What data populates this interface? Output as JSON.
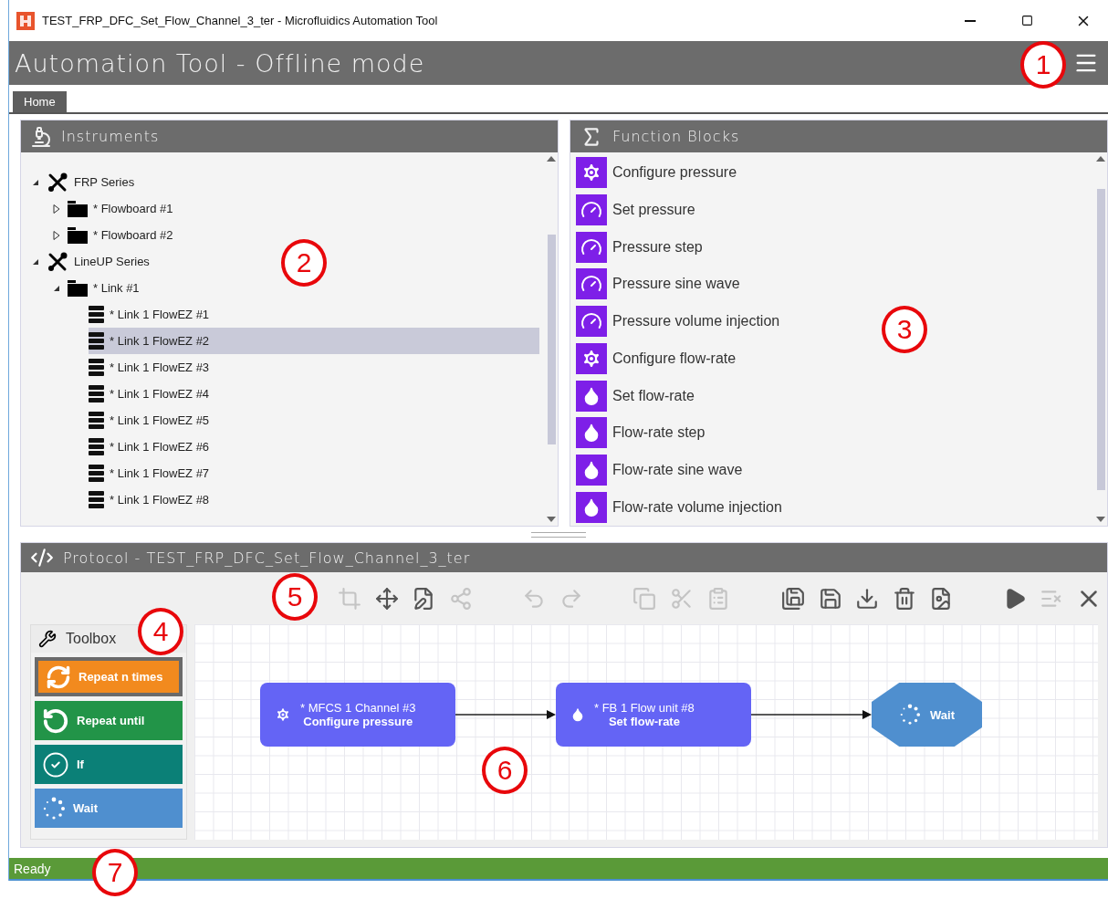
{
  "window": {
    "title": "TEST_FRP_DFC_Set_Flow_Channel_3_ter - Microfluidics Automation Tool"
  },
  "header": {
    "title": "Automation Tool - Offline mode"
  },
  "tabs": [
    {
      "label": "Home",
      "selected": true
    }
  ],
  "instruments": {
    "title": "Instruments",
    "tree": [
      {
        "kind": "series",
        "label": "FRP Series",
        "expanded": true,
        "selected": false,
        "children": [
          {
            "kind": "folder",
            "label": "* Flowboard #1",
            "expanded": false,
            "selected": false
          },
          {
            "kind": "folder",
            "label": "* Flowboard #2",
            "expanded": false,
            "selected": false
          }
        ]
      },
      {
        "kind": "series",
        "label": "LineUP Series",
        "expanded": true,
        "selected": false,
        "children": [
          {
            "kind": "folder",
            "label": "* Link #1",
            "expanded": true,
            "selected": false,
            "children": [
              {
                "kind": "device",
                "label": "* Link 1 FlowEZ #1",
                "selected": false
              },
              {
                "kind": "device",
                "label": "* Link 1 FlowEZ #2",
                "selected": true
              },
              {
                "kind": "device",
                "label": "* Link 1 FlowEZ #3",
                "selected": false
              },
              {
                "kind": "device",
                "label": "* Link 1 FlowEZ #4",
                "selected": false
              },
              {
                "kind": "device",
                "label": "* Link 1 FlowEZ #5",
                "selected": false
              },
              {
                "kind": "device",
                "label": "* Link 1 FlowEZ #6",
                "selected": false
              },
              {
                "kind": "device",
                "label": "* Link 1 FlowEZ #7",
                "selected": false
              },
              {
                "kind": "device",
                "label": "* Link 1 FlowEZ #8",
                "selected": false
              }
            ]
          }
        ]
      }
    ]
  },
  "function_blocks": {
    "title": "Function Blocks",
    "items": [
      {
        "kind": "gear",
        "label": "Configure pressure"
      },
      {
        "kind": "gauge",
        "label": "Set pressure"
      },
      {
        "kind": "gauge",
        "label": "Pressure step"
      },
      {
        "kind": "gauge",
        "label": "Pressure sine wave"
      },
      {
        "kind": "gauge",
        "label": "Pressure volume injection"
      },
      {
        "kind": "gear",
        "label": "Configure flow-rate"
      },
      {
        "kind": "drop",
        "label": "Set flow-rate"
      },
      {
        "kind": "drop",
        "label": "Flow-rate step"
      },
      {
        "kind": "drop",
        "label": "Flow-rate sine wave"
      },
      {
        "kind": "drop",
        "label": "Flow-rate volume injection"
      }
    ]
  },
  "protocol": {
    "title": "Protocol - TEST_FRP_DFC_Set_Flow_Channel_3_ter",
    "toolbar": [
      {
        "kind": "crop",
        "disabled": true
      },
      {
        "kind": "move",
        "disabled": false
      },
      {
        "kind": "edit",
        "disabled": false
      },
      {
        "kind": "connect",
        "disabled": true
      },
      {
        "kind": "undo",
        "disabled": true
      },
      {
        "kind": "redo",
        "disabled": true
      },
      {
        "kind": "copy",
        "disabled": true
      },
      {
        "kind": "cut",
        "disabled": true
      },
      {
        "kind": "paste",
        "disabled": true
      },
      {
        "kind": "saveas",
        "disabled": false
      },
      {
        "kind": "save",
        "disabled": false
      },
      {
        "kind": "import",
        "disabled": false
      },
      {
        "kind": "delete",
        "disabled": false
      },
      {
        "kind": "image",
        "disabled": false
      },
      {
        "kind": "run",
        "disabled": false
      },
      {
        "kind": "list",
        "disabled": true
      },
      {
        "kind": "close",
        "disabled": false
      }
    ],
    "toolbox": {
      "title": "Toolbox",
      "items": [
        {
          "kind": "repeat",
          "label": "Repeat n times",
          "color": "#f28a1e",
          "selected": true
        },
        {
          "kind": "until",
          "label": "Repeat until",
          "color": "#229448",
          "selected": false
        },
        {
          "kind": "if",
          "label": "If",
          "color": "#0b8077",
          "selected": false
        },
        {
          "kind": "wait",
          "label": "Wait",
          "color": "#4f8fcf",
          "selected": false
        }
      ]
    },
    "nodes": [
      {
        "kind": "gear",
        "device": "* MFCS 1 Channel #3",
        "function": "Configure pressure"
      },
      {
        "kind": "drop",
        "device": "* FB 1 Flow unit #8",
        "function": "Set flow-rate"
      },
      {
        "kind": "wait",
        "function": "Wait"
      }
    ]
  },
  "status_bar": {
    "text": "Ready"
  },
  "callouts": [
    "1",
    "2",
    "3",
    "4",
    "5",
    "6",
    "7"
  ]
}
